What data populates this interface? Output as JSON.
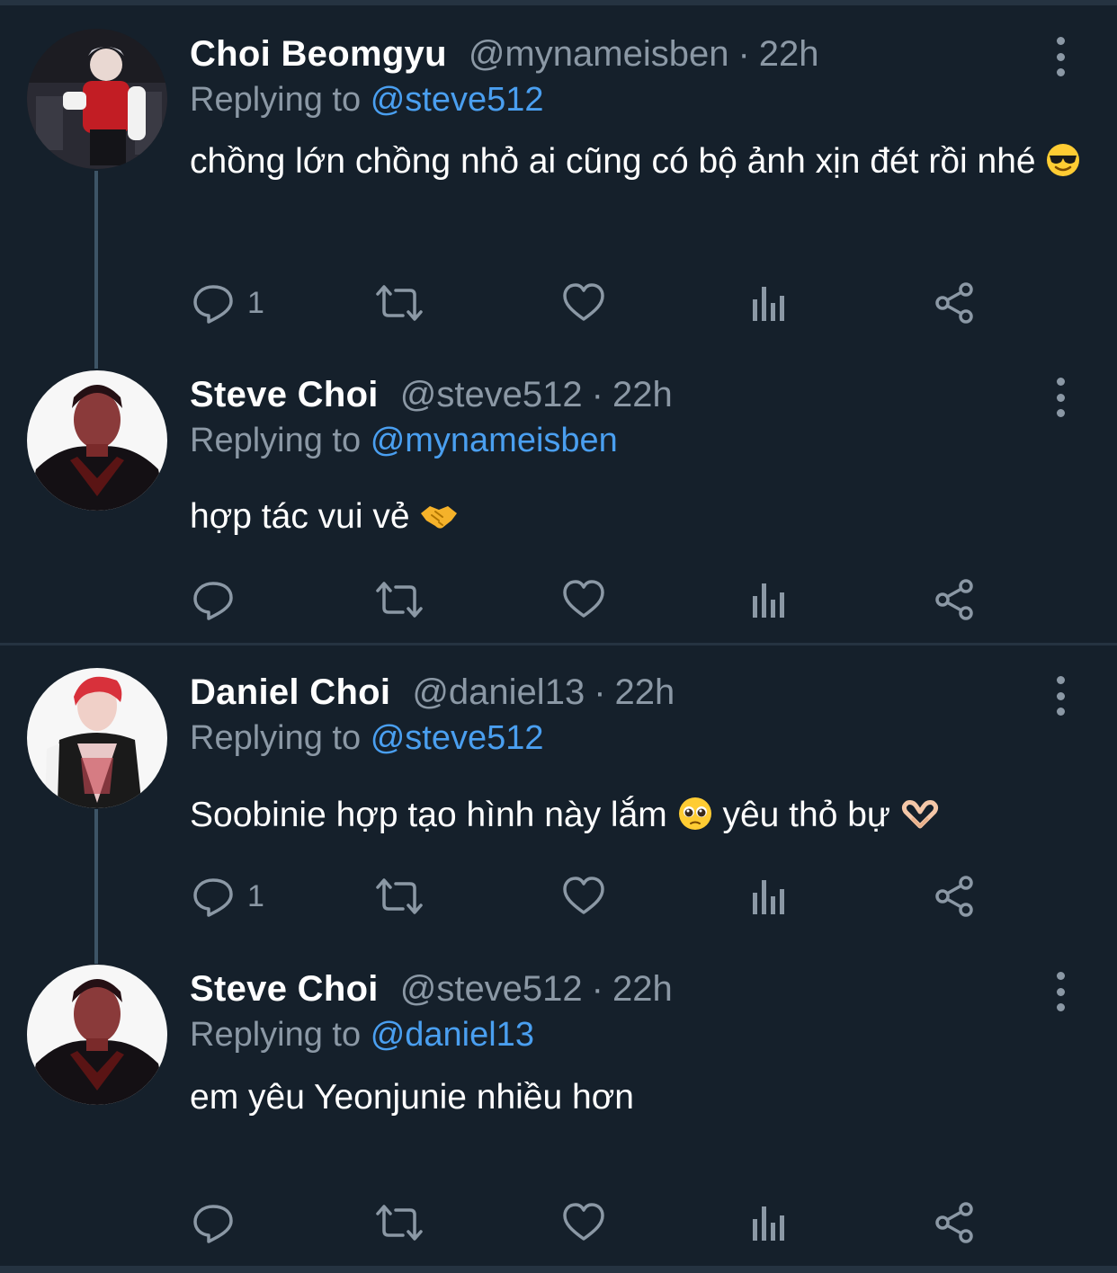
{
  "colors": {
    "background": "#15202b",
    "border": "#253341",
    "text_primary": "#ffffff",
    "text_secondary": "#8b98a5",
    "link": "#4a9ff0"
  },
  "replying_prefix": "Replying to",
  "tweets": [
    {
      "name": "Choi Beomgyu",
      "handle": "@mynameisben",
      "time": "22h",
      "replying_to": "@steve512",
      "text": "chồng lớn chồng nhỏ ai cũng có bộ ảnh xịn đét rồi nhé",
      "emoji": "smiling-face-with-sunglasses",
      "reply_count": "1"
    },
    {
      "name": "Steve Choi",
      "handle": "@steve512",
      "time": "22h",
      "replying_to": "@mynameisben",
      "text": "hợp tác vui vẻ",
      "emoji": "handshake",
      "reply_count": ""
    },
    {
      "name": "Daniel Choi",
      "handle": "@daniel13",
      "time": "22h",
      "replying_to": "@steve512",
      "text_part1": "Soobinie hợp tạo hình này lắm",
      "emoji1": "pleading-face",
      "text_part2": "yêu thỏ bự",
      "emoji2": "heart-hands",
      "reply_count": "1"
    },
    {
      "name": "Steve Choi",
      "handle": "@steve512",
      "time": "22h",
      "replying_to": "@daniel13",
      "text": "em yêu Yeonjunie nhiều hơn",
      "reply_count": ""
    }
  ],
  "icons": {
    "reply": "reply-icon",
    "retweet": "retweet-icon",
    "like": "heart-icon",
    "analytics": "analytics-icon",
    "share": "share-icon",
    "more": "more-vertical-icon"
  }
}
